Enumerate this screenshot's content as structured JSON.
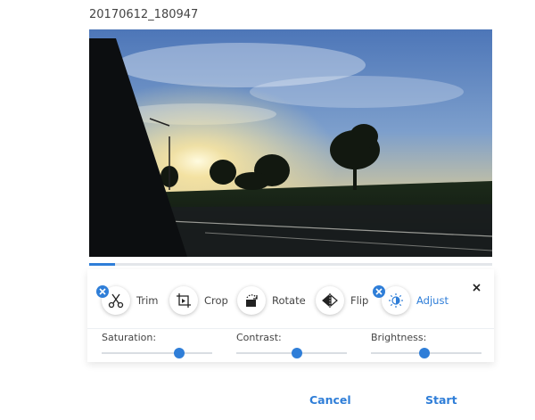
{
  "filename": "20170612_180947",
  "progress": {
    "fraction": 0.065
  },
  "tools": [
    {
      "id": "trim",
      "label": "Trim",
      "icon": "scissors-icon",
      "badge": true,
      "active": false
    },
    {
      "id": "crop",
      "label": "Crop",
      "icon": "crop-icon",
      "badge": false,
      "active": false
    },
    {
      "id": "rotate",
      "label": "Rotate",
      "icon": "rotate-icon",
      "badge": false,
      "active": false
    },
    {
      "id": "flip",
      "label": "Flip",
      "icon": "flip-icon",
      "badge": false,
      "active": false
    },
    {
      "id": "adjust",
      "label": "Adjust",
      "icon": "brightness-icon",
      "badge": true,
      "active": true
    }
  ],
  "sliders": [
    {
      "label": "Saturation:",
      "fraction": 0.7
    },
    {
      "label": "Contrast:",
      "fraction": 0.55
    },
    {
      "label": "Brightness:",
      "fraction": 0.48
    }
  ],
  "footer": {
    "cancel_label": "Cancel",
    "start_label": "Start"
  },
  "colors": {
    "accent": "#2f7ed8"
  }
}
